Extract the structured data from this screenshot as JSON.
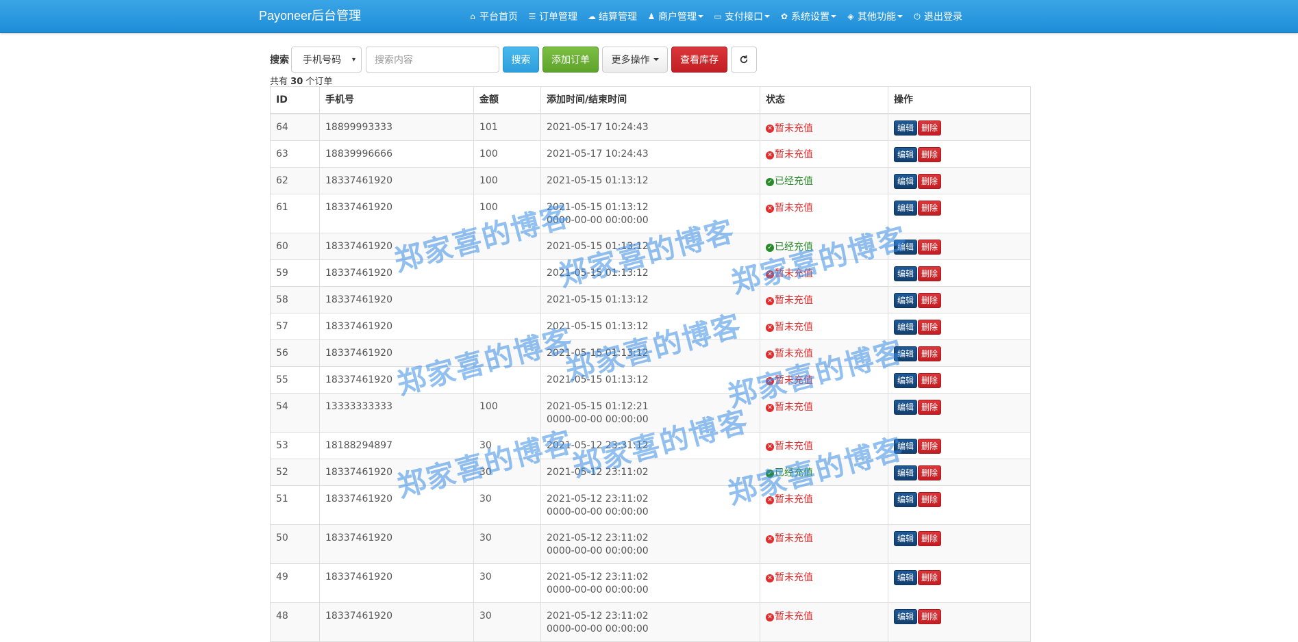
{
  "navbar": {
    "brand": "Payoneer后台管理",
    "items": [
      {
        "label": "平台首页",
        "icon": "home-icon",
        "glyph": "⌂",
        "dropdown": false
      },
      {
        "label": "订单管理",
        "icon": "list-icon",
        "glyph": "☰",
        "dropdown": false
      },
      {
        "label": "结算管理",
        "icon": "cloud-icon",
        "glyph": "☁",
        "dropdown": false
      },
      {
        "label": "商户管理",
        "icon": "user-icon",
        "glyph": "♟",
        "dropdown": true
      },
      {
        "label": "支付接口",
        "icon": "credit-card-icon",
        "glyph": "▭",
        "dropdown": true
      },
      {
        "label": "系统设置",
        "icon": "gear-icon",
        "glyph": "✿",
        "dropdown": true
      },
      {
        "label": "其他功能",
        "icon": "cube-icon",
        "glyph": "◈",
        "dropdown": true
      },
      {
        "label": "退出登录",
        "icon": "power-icon",
        "glyph": "⏻",
        "dropdown": false
      }
    ]
  },
  "toolbar": {
    "search_label": "搜索",
    "select_value": "手机号码",
    "search_placeholder": "搜索内容",
    "search_button": "搜索",
    "add_button": "添加订单",
    "more_button": "更多操作",
    "stock_button": "查看库存",
    "refresh_icon": "refresh-icon"
  },
  "count": {
    "prefix": "共有",
    "value": "30",
    "suffix": "个订单"
  },
  "table": {
    "headers": [
      "ID",
      "手机号",
      "金额",
      "添加时间/结束时间",
      "状态",
      "操作"
    ],
    "edit_label": "编辑",
    "delete_label": "删除",
    "status_labels": {
      "pending": "暂未充值",
      "done": "已经充值"
    },
    "rows": [
      {
        "id": "64",
        "phone": "18899993333",
        "amount": "101",
        "added": "2021-05-17 10:24:43",
        "ended": "",
        "status": "pending"
      },
      {
        "id": "63",
        "phone": "18839996666",
        "amount": "100",
        "added": "2021-05-17 10:24:43",
        "ended": "",
        "status": "pending"
      },
      {
        "id": "62",
        "phone": "18337461920",
        "amount": "100",
        "added": "2021-05-15 01:13:12",
        "ended": "",
        "status": "done"
      },
      {
        "id": "61",
        "phone": "18337461920",
        "amount": "100",
        "added": "2021-05-15 01:13:12",
        "ended": "0000-00-00 00:00:00",
        "status": "pending"
      },
      {
        "id": "60",
        "phone": "18337461920",
        "amount": "",
        "added": "2021-05-15 01:13:12",
        "ended": "",
        "status": "done"
      },
      {
        "id": "59",
        "phone": "18337461920",
        "amount": "",
        "added": "2021-05-15 01:13:12",
        "ended": "",
        "status": "pending"
      },
      {
        "id": "58",
        "phone": "18337461920",
        "amount": "",
        "added": "2021-05-15 01:13:12",
        "ended": "",
        "status": "pending"
      },
      {
        "id": "57",
        "phone": "18337461920",
        "amount": "",
        "added": "2021-05-15 01:13:12",
        "ended": "",
        "status": "pending"
      },
      {
        "id": "56",
        "phone": "18337461920",
        "amount": "",
        "added": "2021-05-15 01:13:12",
        "ended": "",
        "status": "pending"
      },
      {
        "id": "55",
        "phone": "18337461920",
        "amount": "",
        "added": "2021-05-15 01:13:12",
        "ended": "",
        "status": "pending"
      },
      {
        "id": "54",
        "phone": "13333333333",
        "amount": "100",
        "added": "2021-05-15 01:12:21",
        "ended": "0000-00-00 00:00:00",
        "status": "pending"
      },
      {
        "id": "53",
        "phone": "18188294897",
        "amount": "30",
        "added": "2021-05-12 23:31:12",
        "ended": "",
        "status": "pending"
      },
      {
        "id": "52",
        "phone": "18337461920",
        "amount": "30",
        "added": "2021-05-12 23:11:02",
        "ended": "",
        "status": "done"
      },
      {
        "id": "51",
        "phone": "18337461920",
        "amount": "30",
        "added": "2021-05-12 23:11:02",
        "ended": "0000-00-00 00:00:00",
        "status": "pending"
      },
      {
        "id": "50",
        "phone": "18337461920",
        "amount": "30",
        "added": "2021-05-12 23:11:02",
        "ended": "0000-00-00 00:00:00",
        "status": "pending"
      },
      {
        "id": "49",
        "phone": "18337461920",
        "amount": "30",
        "added": "2021-05-12 23:11:02",
        "ended": "0000-00-00 00:00:00",
        "status": "pending"
      },
      {
        "id": "48",
        "phone": "18337461920",
        "amount": "30",
        "added": "2021-05-12 23:11:02",
        "ended": "0000-00-00 00:00:00",
        "status": "pending"
      }
    ]
  },
  "watermark": {
    "text": "郑家喜的博客"
  }
}
